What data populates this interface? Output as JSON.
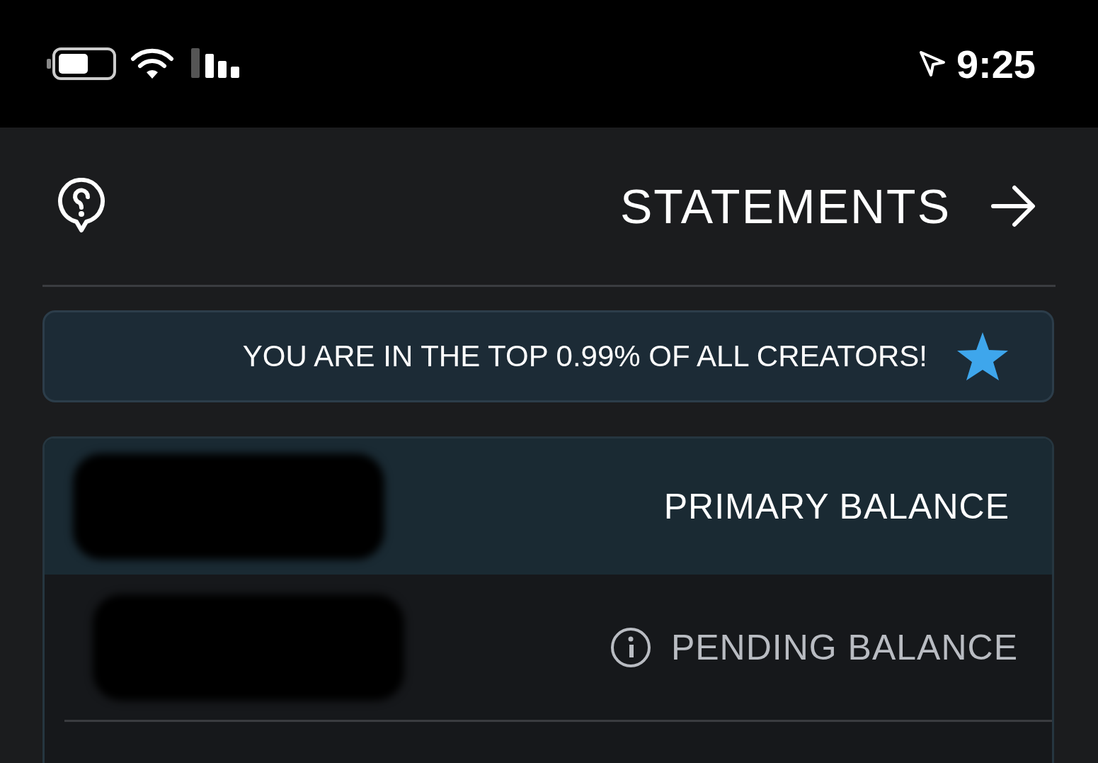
{
  "status_bar": {
    "time": "9:25"
  },
  "header": {
    "title": "STATEMENTS"
  },
  "banner": {
    "text": "YOU ARE IN THE TOP 0.99% OF ALL CREATORS!"
  },
  "balances": [
    {
      "label": "PRIMARY BALANCE",
      "kind": "primary"
    },
    {
      "label": "PENDING BALANCE",
      "kind": "pending"
    }
  ]
}
